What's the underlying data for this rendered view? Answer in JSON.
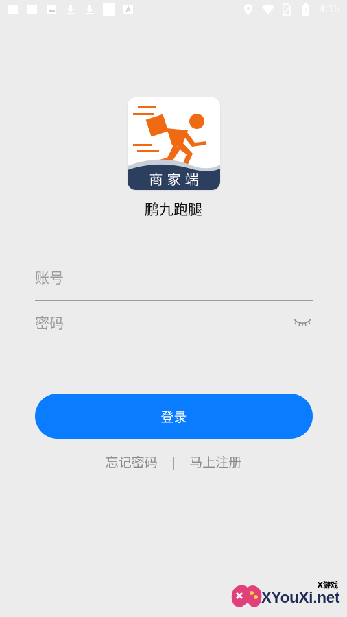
{
  "status_bar": {
    "time": "4:15",
    "left_icons": [
      "square-icon",
      "square-icon",
      "image-icon",
      "download-icon",
      "download-icon",
      "square-icon",
      "a-icon"
    ],
    "right_icons": [
      "location-icon",
      "wifi-icon",
      "no-sim-icon",
      "battery-icon"
    ]
  },
  "logo": {
    "badge_text": "商家端",
    "colors": {
      "runner": "#f06a14",
      "wave_dark": "#2c3f5f"
    }
  },
  "app_name": "鹏九跑腿",
  "form": {
    "account_placeholder": "账号",
    "password_placeholder": "密码",
    "login_label": "登录"
  },
  "links": {
    "forgot": "忘记密码",
    "separator": "|",
    "register": "马上注册"
  },
  "watermark": {
    "top": "X游戏",
    "main": "XYouXi.net"
  }
}
